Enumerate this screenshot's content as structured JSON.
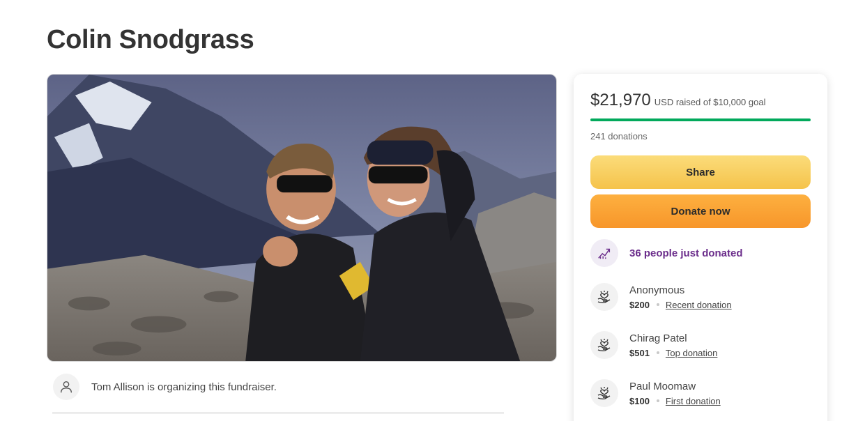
{
  "page_title": "Colin Snodgrass",
  "hero_image": {
    "description_icon": "photo"
  },
  "organizer": {
    "text": "Tom Allison is organizing this fundraiser.",
    "icon": "person-icon"
  },
  "donate_card": {
    "raised_amount": "$21,970",
    "raised_rest": "USD raised of $10,000 goal",
    "progress": 1.0,
    "progress_color": "#02a95c",
    "donations_count": "241 donations",
    "share_label": "Share",
    "donate_label": "Donate now",
    "recent_activity": "36 people just donated",
    "recent_color": "#6b2d8b",
    "donors": [
      {
        "name": "Anonymous",
        "amount": "$200",
        "tag": "Recent donation"
      },
      {
        "name": "Chirag Patel",
        "amount": "$501",
        "tag": "Top donation"
      },
      {
        "name": "Paul Moomaw",
        "amount": "$100",
        "tag": "First donation"
      }
    ]
  }
}
